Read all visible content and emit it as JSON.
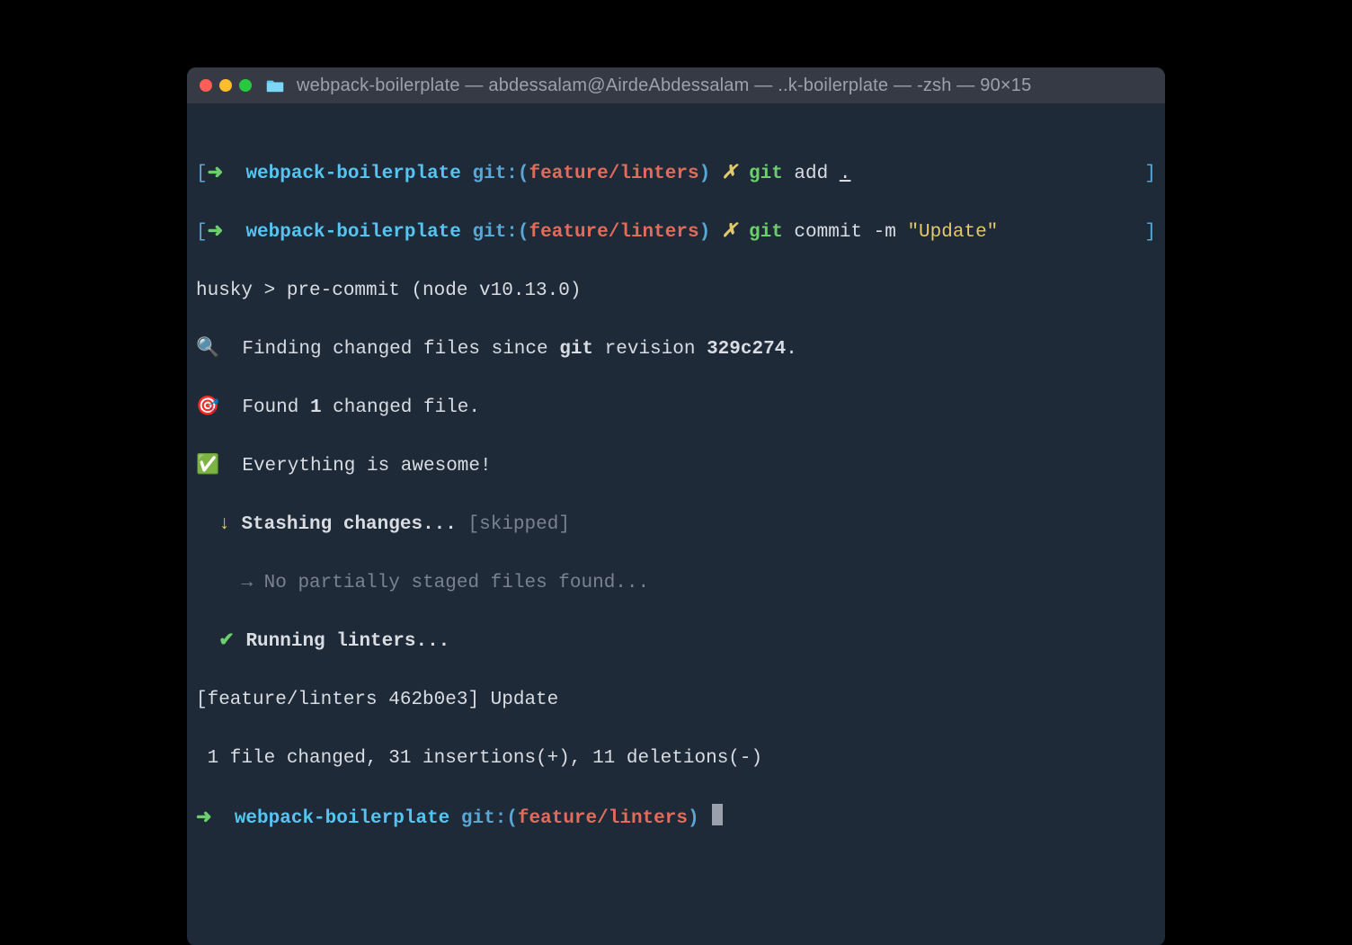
{
  "window": {
    "title": "webpack-boilerplate — abdessalam@AirdeAbdessalam — ..k-boilerplate — -zsh — 90×15"
  },
  "prompt": {
    "bracket_open": "[",
    "arrow": "➜",
    "dir": "webpack-boilerplate",
    "git_label": "git:",
    "paren_open": "(",
    "branch": "feature/linters",
    "paren_close": ")",
    "dirty": "✗",
    "bracket_close": "]"
  },
  "cmd1": {
    "bin": "git",
    "rest": "add ",
    "dot": "."
  },
  "cmd2": {
    "bin": "git",
    "rest": "commit -m ",
    "msg": "\"Update\""
  },
  "lines": {
    "husky": "husky > pre-commit (node v10.13.0)",
    "find_pre": "🔍  Finding changed files since ",
    "find_git": "git",
    "find_mid": " revision ",
    "find_rev": "329c274",
    "find_dot": ".",
    "found_pre": "🎯  Found ",
    "found_n": "1",
    "found_post": " changed file.",
    "awesome": "✅  Everything is awesome!",
    "stash_arrow": "↓",
    "stash_text": "Stashing changes...",
    "stash_status": "[skipped]",
    "partial_arrow": "→",
    "partial_text": "No partially staged files found...",
    "lint_check": "✔",
    "lint_text": "Running linters...",
    "commit_line": "[feature/linters 462b0e3] Update",
    "stats": " 1 file changed, 31 insertions(+), 11 deletions(-)"
  }
}
